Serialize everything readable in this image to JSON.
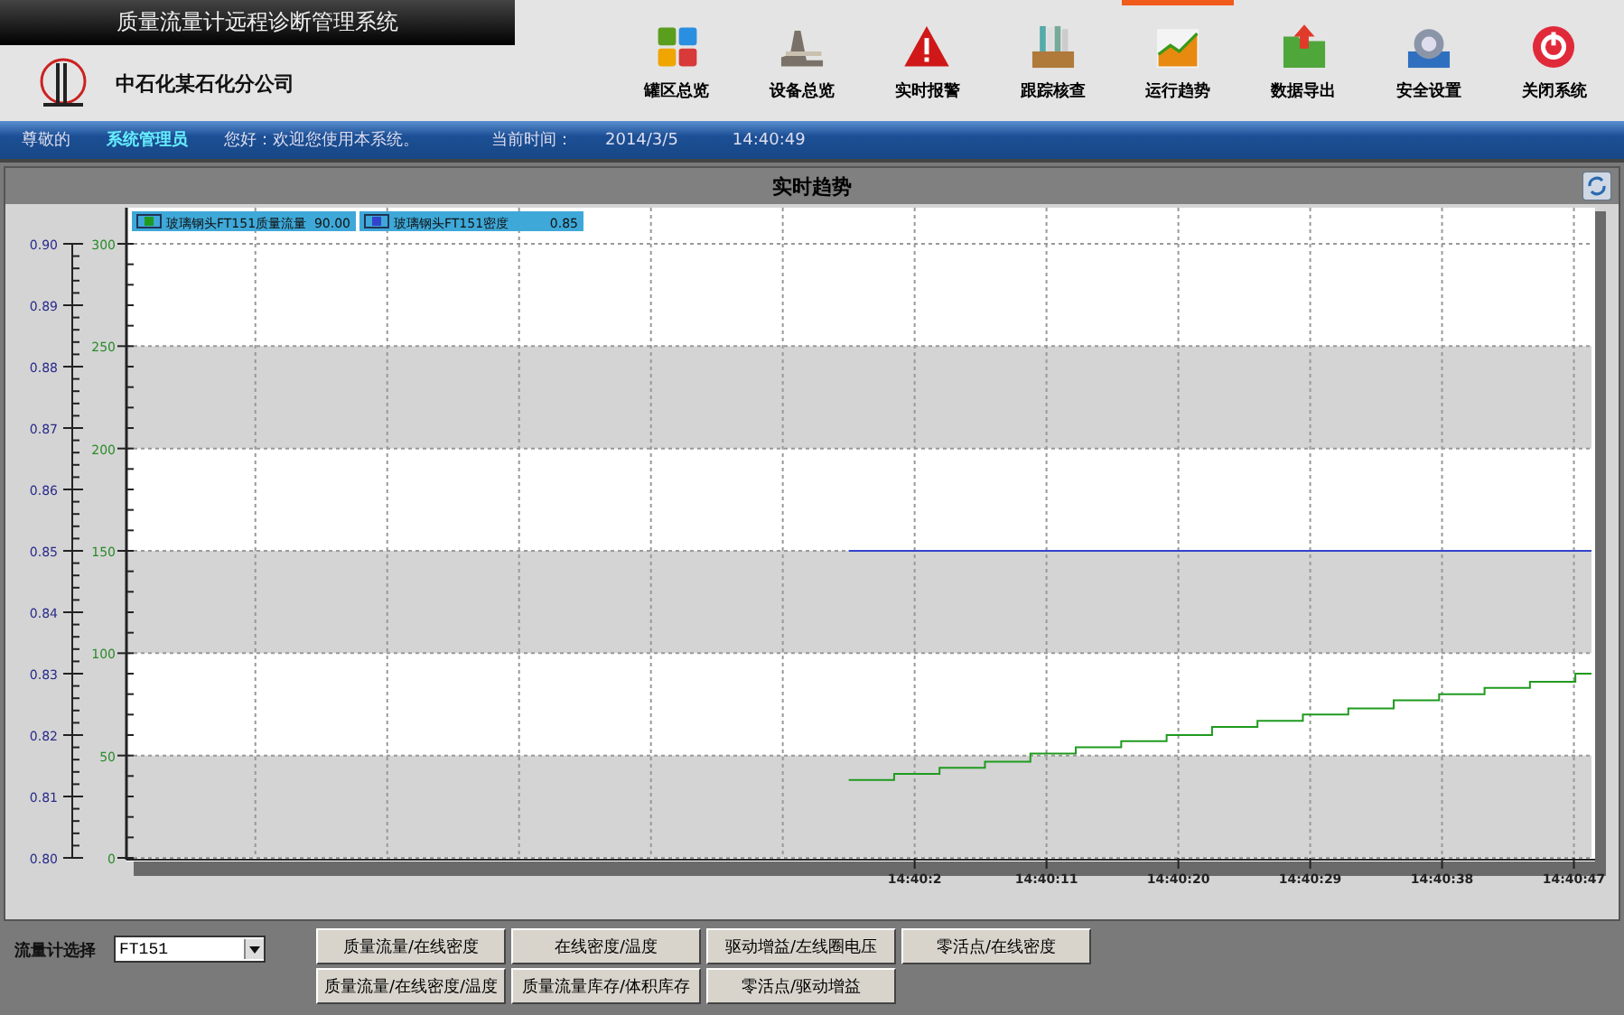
{
  "app_title": "质量流量计远程诊断管理系统",
  "company": "中石化某石化分公司",
  "nav": [
    {
      "label": "罐区总览",
      "kind": "tiles",
      "selected": false
    },
    {
      "label": "设备总览",
      "kind": "device",
      "selected": false
    },
    {
      "label": "实时报警",
      "kind": "alarm",
      "selected": false
    },
    {
      "label": "跟踪核查",
      "kind": "files",
      "selected": false
    },
    {
      "label": "运行趋势",
      "kind": "trend",
      "selected": true
    },
    {
      "label": "数据导出",
      "kind": "export",
      "selected": false
    },
    {
      "label": "安全设置",
      "kind": "settings",
      "selected": false
    },
    {
      "label": "关闭系统",
      "kind": "power",
      "selected": false
    }
  ],
  "status_bar": {
    "greeting": "尊敬的",
    "user": "系统管理员",
    "welcome": "您好：欢迎您使用本系统。",
    "time_label": "当前时间：",
    "date": "2014/3/5",
    "time": "14:40:49"
  },
  "trend_panel": {
    "title": "实时趋势",
    "legend": [
      {
        "value": "90.00"
      },
      {
        "value": "0.85"
      }
    ],
    "chart_data": {
      "type": "line",
      "grid": true,
      "legend": "top-left",
      "xlim": [
        52748.2,
        52848.2
      ],
      "ylim": [
        0,
        300
      ],
      "yticks": [
        0,
        50,
        100,
        150,
        200,
        250,
        300
      ],
      "y2lim": [
        0.8,
        0.9
      ],
      "y2ticks": [
        {
          "value": 0.8,
          "label": "0.80"
        },
        {
          "value": 0.81,
          "label": "0.81"
        },
        {
          "value": 0.82,
          "label": "0.82"
        },
        {
          "value": 0.83,
          "label": "0.83"
        },
        {
          "value": 0.84,
          "label": "0.84"
        },
        {
          "value": 0.85,
          "label": "0.85"
        },
        {
          "value": 0.86,
          "label": "0.86"
        },
        {
          "value": 0.87,
          "label": "0.87"
        },
        {
          "value": 0.88,
          "label": "0.88"
        },
        {
          "value": 0.89,
          "label": "0.89"
        },
        {
          "value": 0.9,
          "label": "0.90"
        }
      ],
      "xticks": [
        {
          "value": 52802,
          "label": "14:40:2"
        },
        {
          "value": 52811,
          "label": "14:40:11"
        },
        {
          "value": 52820,
          "label": "14:40:20"
        },
        {
          "value": 52829,
          "label": "14:40:29"
        },
        {
          "value": 52838,
          "label": "14:40:38"
        },
        {
          "value": 52847,
          "label": "14:40:47"
        }
      ],
      "x": [
        52797.5,
        52800.6,
        52803.7,
        52806.8,
        52809.9,
        52813.0,
        52816.1,
        52819.2,
        52822.3,
        52825.4,
        52828.5,
        52831.6,
        52834.7,
        52837.8,
        52840.9,
        52844.0,
        52847.1,
        52848.2
      ],
      "series": [
        {
          "name": "玻璃钢头FT151质量流量",
          "color": "#1f9a1f",
          "axis": "y",
          "values": [
            38,
            41,
            44,
            47,
            51,
            54,
            57,
            60,
            64,
            67,
            70,
            73,
            77,
            80,
            83,
            86,
            90,
            90
          ]
        },
        {
          "name": "玻璃钢头FT151密度",
          "color": "#3344cc",
          "axis": "y2",
          "values": [
            0.85,
            0.85,
            0.85,
            0.85,
            0.85,
            0.85,
            0.85,
            0.85,
            0.85,
            0.85,
            0.85,
            0.85,
            0.85,
            0.85,
            0.85,
            0.85,
            0.85,
            0.85
          ]
        }
      ]
    }
  },
  "controls": {
    "meter_label": "流量计选择",
    "meter_value": "FT151",
    "buttons": [
      "质量流量/在线密度",
      "在线密度/温度",
      "驱动增益/左线圈电压",
      "零活点/在线密度",
      "质量流量/在线密度/温度",
      "质量流量库存/体积库存",
      "零活点/驱动增益"
    ]
  }
}
